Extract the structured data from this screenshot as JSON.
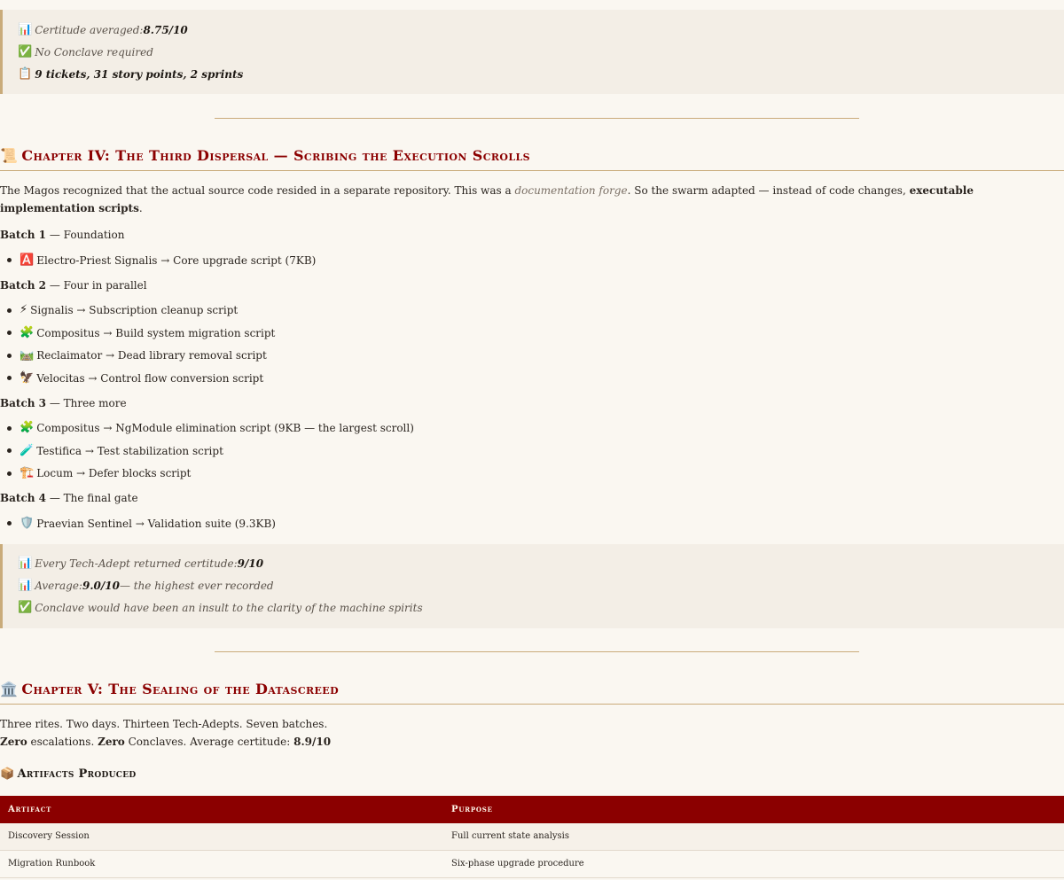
{
  "summary_top": [
    {
      "icon": "📊",
      "icon_name": "bar-chart-icon",
      "text": "Certitude averaged: ",
      "strong": "8.75/10"
    },
    {
      "icon": "✅",
      "icon_name": "check-mark-icon",
      "text": "No Conclave required",
      "strong": ""
    },
    {
      "icon": "📋",
      "icon_name": "clipboard-icon",
      "text": "",
      "strong": "9 tickets, 31 story points, 2 sprints"
    }
  ],
  "chapter4": {
    "icon": "📜",
    "title": "Chapter IV: The Third Dispersal — Scribing the Execution Scrolls",
    "intro_a": "The Magos recognized that the actual source code resided in a separate repository. This was a ",
    "intro_em": "documentation forge",
    "intro_b": ". So the swarm adapted — instead of code changes, ",
    "intro_strong": "executable implementation scripts",
    "intro_c": ".",
    "batches": [
      {
        "label": "Batch 1",
        "desc": " — Foundation",
        "items": [
          {
            "icon": "🅰️",
            "icon_name": "a-button-icon",
            "text": "Electro-Priest Signalis → Core upgrade script (7KB)"
          }
        ]
      },
      {
        "label": "Batch 2",
        "desc": " — Four in parallel",
        "items": [
          {
            "icon": "⚡",
            "icon_name": "lightning-icon",
            "text": "Signalis → Subscription cleanup script"
          },
          {
            "icon": "🧩",
            "icon_name": "puzzle-icon",
            "text": "Compositus → Build system migration script"
          },
          {
            "icon": "🛤️",
            "icon_name": "railway-icon",
            "text": "Reclaimator → Dead library removal script"
          },
          {
            "icon": "🦅",
            "icon_name": "eagle-icon",
            "text": "Velocitas → Control flow conversion script"
          }
        ]
      },
      {
        "label": "Batch 3",
        "desc": " — Three more",
        "items": [
          {
            "icon": "🧩",
            "icon_name": "puzzle-icon",
            "text": "Compositus → NgModule elimination script (9KB — the largest scroll)"
          },
          {
            "icon": "🧪",
            "icon_name": "test-tube-icon",
            "text": "Testifica → Test stabilization script"
          },
          {
            "icon": "🏗️",
            "icon_name": "construction-icon",
            "text": "Locum → Defer blocks script"
          }
        ]
      },
      {
        "label": "Batch 4",
        "desc": " — The final gate",
        "items": [
          {
            "icon": "🛡️",
            "icon_name": "shield-icon",
            "text": "Praevian Sentinel → Validation suite (9.3KB)"
          }
        ]
      }
    ],
    "summary": [
      {
        "icon": "📊",
        "icon_name": "bar-chart-icon",
        "text": "Every Tech-Adept returned certitude: ",
        "strong": "9/10",
        "tail": ""
      },
      {
        "icon": "📊",
        "icon_name": "bar-chart-icon",
        "text": "Average: ",
        "strong": "9.0/10",
        "tail": " — the highest ever recorded"
      },
      {
        "icon": "✅",
        "icon_name": "check-mark-icon",
        "text": "Conclave would have been an insult to the clarity of the machine spirits",
        "strong": "",
        "tail": ""
      }
    ]
  },
  "chapter5": {
    "icon": "🏛️",
    "title": "Chapter V: The Sealing of the Datascreed",
    "line1": "Three rites. Two days. Thirteen Tech-Adepts. Seven batches.",
    "zero1": "Zero",
    "esc": " escalations. ",
    "zero2": "Zero",
    "conc": " Conclaves. Average certitude: ",
    "avg": "8.9/10"
  },
  "artifacts": {
    "icon": "📦",
    "heading": "Artifacts Produced",
    "columns": [
      "Artifact",
      "Purpose"
    ],
    "rows": [
      [
        "Discovery Session",
        "Full current state analysis"
      ],
      [
        "Migration Runbook",
        "Six-phase upgrade procedure"
      ]
    ]
  }
}
